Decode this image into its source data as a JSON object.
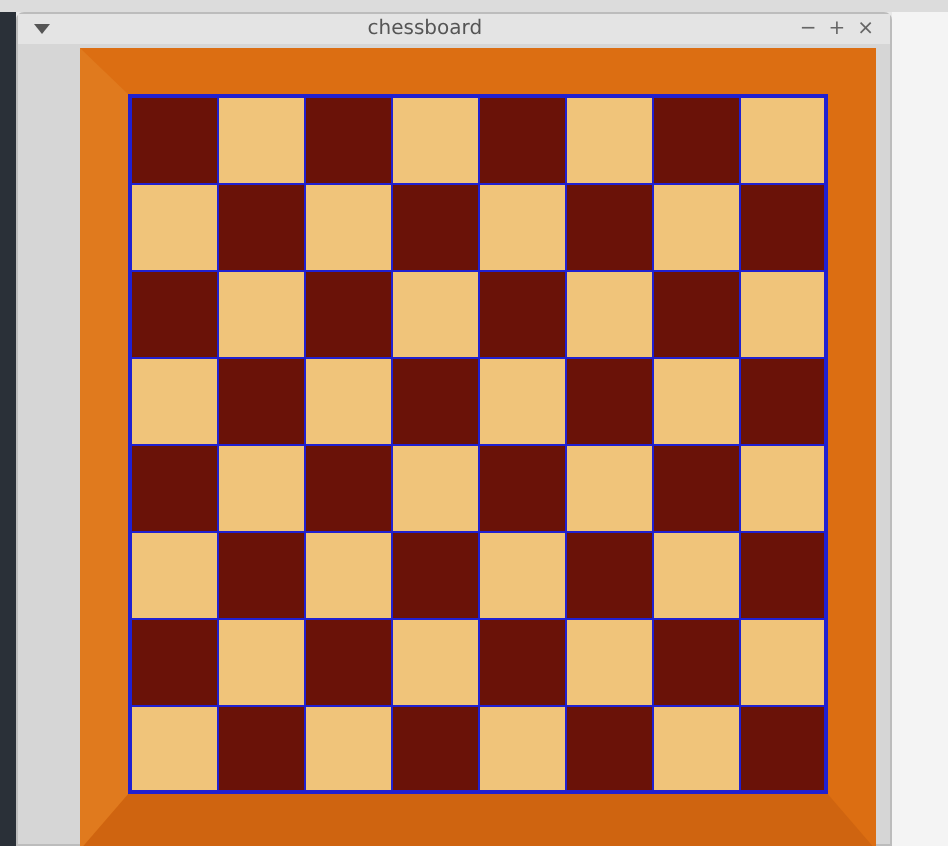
{
  "window": {
    "title": "chessboard",
    "controls": [
      "−",
      "+",
      "×"
    ]
  }
}
